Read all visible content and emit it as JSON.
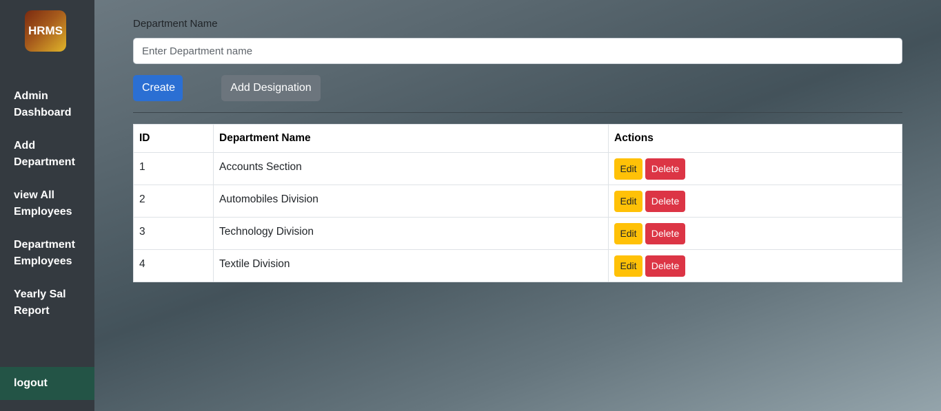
{
  "sidebar": {
    "logo": "HRMS",
    "items": [
      {
        "label": "Admin Dashboard"
      },
      {
        "label": "Add Department"
      },
      {
        "label": "view All Employees"
      },
      {
        "label": "Department Employees"
      },
      {
        "label": "Yearly Sal Report"
      }
    ],
    "logout": "logout"
  },
  "form": {
    "label": "Department Name",
    "placeholder": "Enter Department name",
    "value": "",
    "create_label": "Create",
    "designation_label": "Add Designation"
  },
  "table": {
    "headers": [
      "ID",
      "Department Name",
      "Actions"
    ],
    "rows": [
      {
        "id": "1",
        "name": "Accounts Section"
      },
      {
        "id": "2",
        "name": "Automobiles Division"
      },
      {
        "id": "3",
        "name": "Technology Division"
      },
      {
        "id": "4",
        "name": "Textile Division"
      }
    ],
    "edit_label": "Edit",
    "delete_label": "Delete"
  },
  "colors": {
    "sidebar_bg": "#343a40",
    "logout_bg": "#235446",
    "primary": "#2b6fd3",
    "secondary": "#6c757d",
    "warning": "#ffc107",
    "danger": "#dc3545"
  }
}
